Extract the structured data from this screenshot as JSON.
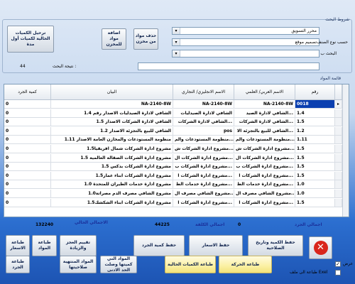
{
  "filters": {
    "group_title": "شروط البحث",
    "combo1_value": "محرر التسويق",
    "combo2_value": "تصميم موقع",
    "combo3_value": "",
    "sort_label": "حسب نوع الصنف",
    "search_label": "البحث ب",
    "result_label": "نتيجة البحث :",
    "result_count": "44"
  },
  "buttons": {
    "transfer": "ترحيل الكميات الحالية لكميات أول مدة",
    "add": "اضافة مواد للمخزن",
    "delete": "حذف مواد من مخزن"
  },
  "grid": {
    "title": "قائمة المواد",
    "columns": [
      "رقم",
      "الاسم العربي/ العلمي",
      "الاسم الانجليزي/ التجاري",
      "البيان",
      "كمية الجرد"
    ],
    "rows": [
      {
        "num": "0018",
        "arabic": "NA-2140-8W",
        "english": "NA-2140-8W",
        "desc": "NA-2140-8W",
        "qty": "0",
        "marker": "▸"
      },
      {
        "num": "1.4",
        "arabic": "الشافي لادارة الصيد...",
        "english": "الشافي لادارة الصيدليات",
        "desc": "الشافي لادارة الصيدليات الاصدار رقم  1.4",
        "qty": "0",
        "marker": ""
      },
      {
        "num": "1.5",
        "arabic": "الشافي لادارة الشركات...",
        "english": "الشافي لادارة الشركات...",
        "desc": "الشافي لادارة الشركات الاصدار 1.5",
        "qty": "0",
        "marker": ""
      },
      {
        "num": "1.2",
        "arabic": "الشافي للبيع بالتجزئة الا...",
        "english": "pos",
        "desc": "الشافي للبيع بالتجزئة الاصدار 1.2",
        "qty": "0",
        "marker": ""
      },
      {
        "num": "1.11",
        "arabic": "منظومة المستودعات والم...",
        "english": "منظومة المستودعات والم...",
        "desc": "منظومة المستودعات والمخازن العامة الاصدار 1.11",
        "qty": "0",
        "marker": ""
      },
      {
        "num": "1.5",
        "arabic": "مشروع ادارة الشركات ش...",
        "english": "مشروع ادارة الشركات ش...",
        "desc": "مشروع ادارة الشركات شمال افريقيا1.5",
        "qty": "0",
        "marker": ""
      },
      {
        "num": "1.5",
        "arabic": "مشروع ادارة الشركات ال...",
        "english": "مشروع ادارة الشركات ال...",
        "desc": "مشروع ادارة الشركات الصقالة العالمية 1.5",
        "qty": "0",
        "marker": ""
      },
      {
        "num": "1.5",
        "arabic": "مشروع ادارة الشركات ب...",
        "english": "مشروع ادارة الشركات ب...",
        "desc": "مشروع ادارة الشركات بدكس 1.5",
        "qty": "0",
        "marker": ""
      },
      {
        "num": "1.5",
        "arabic": "مشروع ادارة الشركات ا...",
        "english": "مشروع ادارة الشركات ا...",
        "desc": "مشروع ادارة الشركات ابناء عمار1.5",
        "qty": "0",
        "marker": ""
      },
      {
        "num": "1.0",
        "arabic": "مشروع ادارة خدمات الط...",
        "english": "مشروع ادارة خدمات الط...",
        "desc": "مشروع ادارة خدمات الطيران للمتحدة 1.0",
        "qty": "0",
        "marker": ""
      },
      {
        "num": "1.0",
        "arabic": "مشروع الشافي مصرف ال...",
        "english": "مشروع الشافي مصرف ال...",
        "desc": "مشروع الشافي مصرف الدم مصراتة1.0",
        "qty": "0",
        "marker": ""
      },
      {
        "num": "1.5",
        "arabic": "مشروع ادارة الشركات ا...",
        "english": "مشروع ادارة الشركات ا...",
        "desc": "مشروع ادارة الشركات ابناء الشكشك1.5",
        "qty": "0",
        "marker": ""
      }
    ]
  },
  "totals": {
    "inventory_label": "اجمالي الجرد",
    "inventory_value": "0",
    "cost_label": "اجمالي الكلفة",
    "cost_value": "44225",
    "current_label": "الاجمالي الحالي",
    "current_value": "132240"
  },
  "actions": {
    "save_qty": "حفظ الكمية وتاريخ الصلاحية",
    "save_prices": "حفظ الاسعار",
    "save_inventory_qty": "حفظ كمية الجرد",
    "evaluate": "تقييم العجز والزيادة",
    "print_materials": "طباعة المواد",
    "print_prices": "طباعة الاسعار",
    "print_movement": "طباعة الحركة",
    "print_current_qty": "طباعة الكميات الحالية",
    "materials_min": "المواد التي كميتها وصلت الحد الادنى",
    "expired": "المواد المنتهية صلاحيتها",
    "print_inventory": "طباعة الجرد",
    "show_label": "عرض",
    "excel_label": "طباعة الى ملف Exel",
    "close_icon": "close-icon"
  },
  "colors": {
    "close_red": "#d9261c",
    "highlight_blue": "#0b3fb0",
    "bg_blue": "#2c6fd0"
  }
}
